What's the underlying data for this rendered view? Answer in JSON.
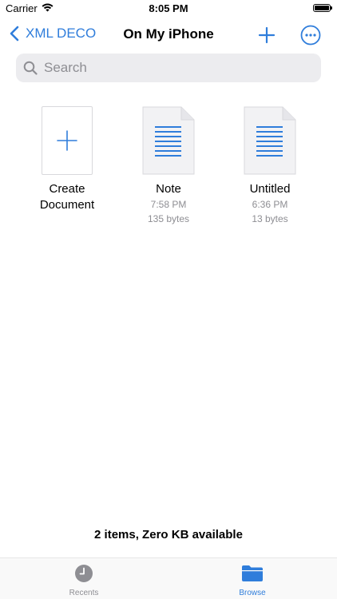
{
  "status_bar": {
    "carrier": "Carrier",
    "time": "8:05 PM"
  },
  "nav": {
    "back_label": "XML DECO",
    "title": "On My iPhone"
  },
  "search": {
    "placeholder": "Search"
  },
  "items": [
    {
      "name_line1": "Create",
      "name_line2": "Document",
      "icon": "plus-icon"
    },
    {
      "name": "Note",
      "time": "7:58 PM",
      "size": "135 bytes",
      "icon": "document-icon"
    },
    {
      "name": "Untitled",
      "time": "6:36 PM",
      "size": "13 bytes",
      "icon": "document-icon"
    }
  ],
  "footer": {
    "info": "2 items, Zero KB available"
  },
  "tabs": [
    {
      "label": "Recents",
      "icon": "clock-icon",
      "selected": false
    },
    {
      "label": "Browse",
      "icon": "folder-icon",
      "selected": true
    }
  ],
  "colors": {
    "accent": "#2f7ddb",
    "secondary_text": "#8e8e93",
    "search_background": "#ececef"
  }
}
